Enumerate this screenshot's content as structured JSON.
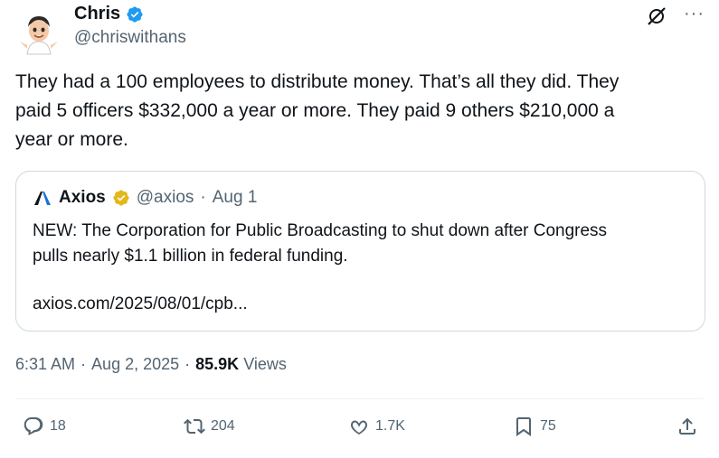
{
  "author": {
    "name": "Chris",
    "handle": "@chriswithans"
  },
  "tweet": {
    "text": "They had a 100 employees to distribute money.  That’s all they did.  They\npaid 5 officers $332,000 a year or more.  They paid 9 others $210,000 a\nyear or more."
  },
  "quote": {
    "name": "Axios",
    "handle": "@axios",
    "separator": "·",
    "date": "Aug 1",
    "text": "NEW: The Corporation for Public Broadcasting to shut down after Congress\npulls nearly $1.1 billion in federal funding.",
    "link": "axios.com/2025/08/01/cpb..."
  },
  "meta": {
    "time": "6:31 AM",
    "dot1": "·",
    "date": "Aug 2, 2025",
    "dot2": "·",
    "views_count": "85.9K",
    "views_label": "Views"
  },
  "actions": {
    "replies": "18",
    "reposts": "204",
    "likes": "1.7K",
    "bookmarks": "75"
  },
  "colors": {
    "verified_blue": "#1d9bf0",
    "verified_gold": "#e2b719",
    "secondary_text": "#536471",
    "border": "#cfd9de"
  },
  "icons": [
    "grok-icon",
    "more-icon",
    "reply-icon",
    "repost-icon",
    "like-icon",
    "bookmark-icon",
    "share-icon",
    "verified-badge-icon"
  ]
}
